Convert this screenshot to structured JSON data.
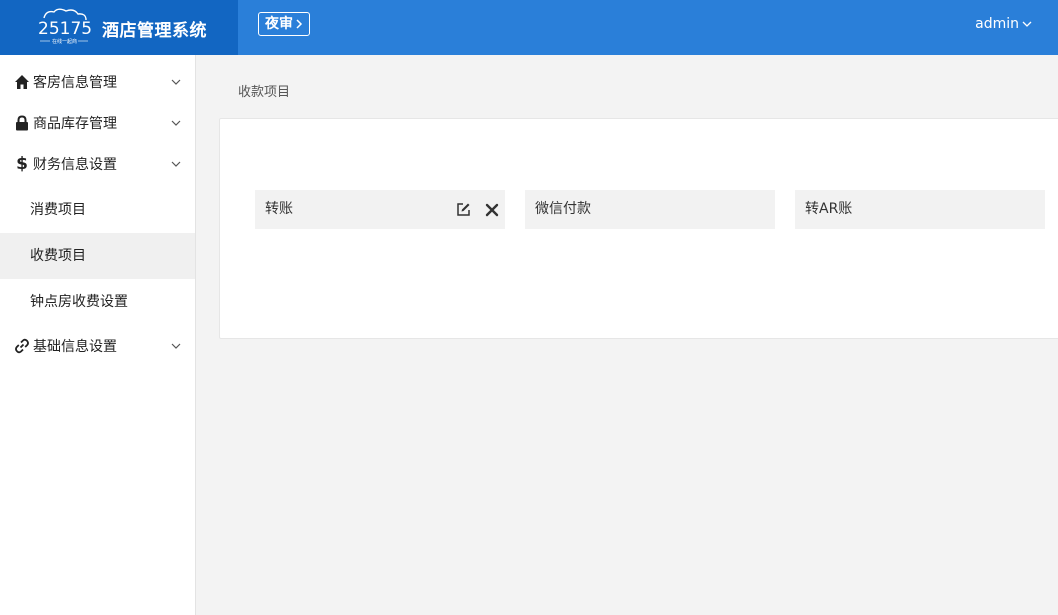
{
  "header": {
    "logo_text": "25175",
    "logo_tagline": "在线一起商",
    "title": "酒店管理系统",
    "night_audit_label": "夜审",
    "user_name": "admin"
  },
  "sidebar": {
    "groups": [
      {
        "label": "客房信息管理",
        "icon": "home-icon"
      },
      {
        "label": "商品库存管理",
        "icon": "lock-icon"
      },
      {
        "label": "财务信息设置",
        "icon": "dollar-icon"
      },
      {
        "label": "基础信息设置",
        "icon": "link-icon"
      }
    ],
    "finance_items": [
      {
        "label": "消费项目"
      },
      {
        "label": "收费项目"
      },
      {
        "label": "钟点房收费设置"
      }
    ]
  },
  "main": {
    "breadcrumb": "收款项目",
    "items": [
      {
        "label": "转账"
      },
      {
        "label": "微信付款"
      },
      {
        "label": "转AR账"
      }
    ]
  },
  "colors": {
    "header_bg": "#2a7fd9",
    "brand_bg": "#1266c2",
    "active_item_bg": "#f0f0f0"
  }
}
